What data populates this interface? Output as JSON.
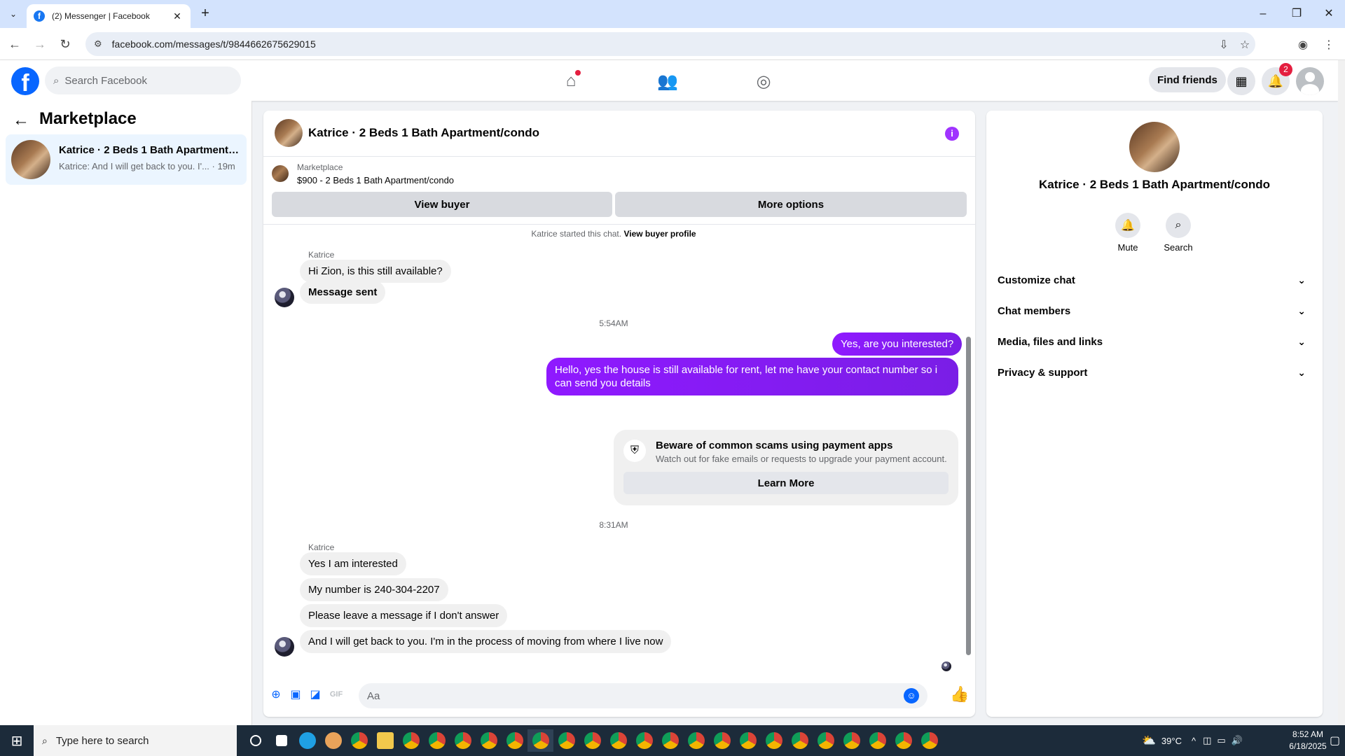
{
  "browser": {
    "tab_title": "(2) Messenger | Facebook",
    "url": "facebook.com/messages/t/9844662675629015"
  },
  "fb_header": {
    "search_placeholder": "Search Facebook",
    "find_friends_label": "Find friends",
    "notification_count": "2"
  },
  "sidebar": {
    "title": "Marketplace",
    "conversations": [
      {
        "name": "Katrice · 2 Beds 1 Bath Apartment/condo",
        "preview": "Katrice: And I will get back to you. I'... · 19m"
      }
    ]
  },
  "chat": {
    "header_name": "Katrice · 2 Beds 1 Bath Apartment/condo",
    "marketplace_label": "Marketplace",
    "listing": "$900 - 2 Beds 1 Bath Apartment/condo",
    "view_buyer_label": "View buyer",
    "more_options_label": "More options",
    "system_note": "Katrice started this chat.",
    "system_note_link": "View buyer profile",
    "sender_name": "Katrice",
    "group1": [
      "Hi Zion, is this still available?",
      "Message sent"
    ],
    "timestamp1": "5:54AM",
    "outgoing": [
      "Yes, are you interested?",
      "Hello, yes the house is still available for rent, let me have your contact number so i can send you details"
    ],
    "scam_notice": {
      "title": "Beware of common scams using payment apps",
      "subtitle": "Watch out for fake emails or requests to upgrade your payment account.",
      "button": "Learn More"
    },
    "timestamp2": "8:31AM",
    "group2": [
      "Yes I am interested",
      "My number is 240-304-2207",
      "Please leave a message if I don't answer",
      "And I will get back to you. I'm in the process of moving from where I live now"
    ],
    "composer_placeholder": "Aa"
  },
  "info_panel": {
    "name": "Katrice · 2 Beds 1 Bath Apartment/condo",
    "mute_label": "Mute",
    "search_label": "Search",
    "sections": [
      "Customize chat",
      "Chat members",
      "Media, files and links",
      "Privacy & support"
    ]
  },
  "taskbar": {
    "search_placeholder": "Type here to search",
    "temperature": "39°C",
    "time": "8:52 AM",
    "date": "6/18/2025"
  },
  "colors": {
    "accent": "#0866ff",
    "outgoing_bubble": "#8f19ff",
    "incoming_bubble": "#f0f0f0",
    "notification_red": "#e41e3f"
  }
}
